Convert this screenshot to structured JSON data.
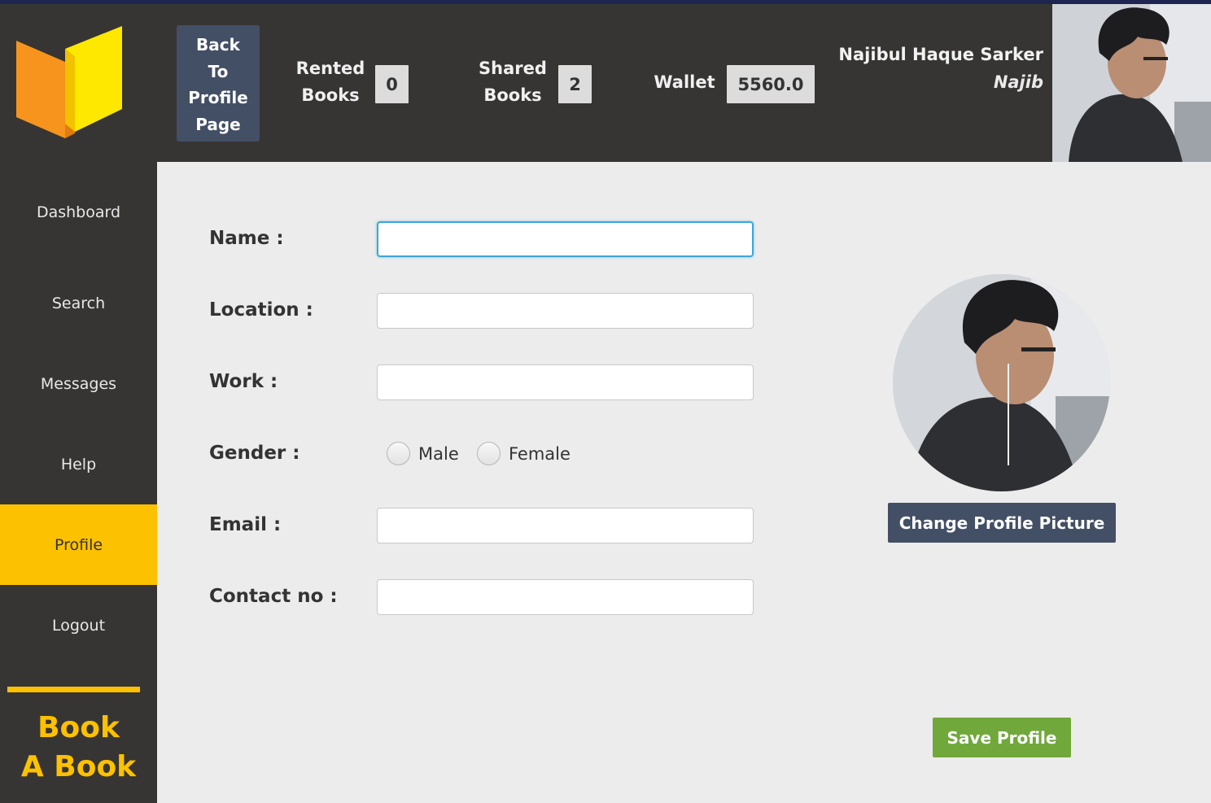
{
  "header": {
    "back_button": "Back\nTo\nProfile\nPage",
    "rented_label": "Rented\nBooks",
    "rented_value": "0",
    "shared_label": "Shared\nBooks",
    "shared_value": "2",
    "wallet_label": "Wallet",
    "wallet_value": "5560.0",
    "user_name": "Najibul Haque Sarker",
    "user_nickname": "Najib"
  },
  "sidebar": {
    "items": [
      {
        "label": "Dashboard"
      },
      {
        "label": "Search"
      },
      {
        "label": "Messages"
      },
      {
        "label": "Help"
      },
      {
        "label": "Profile",
        "active": true
      },
      {
        "label": "Logout"
      }
    ],
    "brand_line1": "Book",
    "brand_line2": "A Book"
  },
  "form": {
    "name_label": "Name :",
    "name_value": "",
    "location_label": "Location :",
    "location_value": "",
    "work_label": "Work :",
    "work_value": "",
    "gender_label": "Gender :",
    "gender_options": [
      "Male",
      "Female"
    ],
    "email_label": "Email :",
    "email_value": "",
    "contact_label": "Contact no :",
    "contact_value": ""
  },
  "profile_picture": {
    "change_button": "Change Profile Picture"
  },
  "save_button": "Save Profile",
  "colors": {
    "dark_bg": "#373533",
    "accent_yellow": "#fcc100",
    "button_slate": "#434f65",
    "save_green": "#70a83c",
    "content_bg": "#ececec",
    "focus_blue": "#3ea6d8"
  }
}
